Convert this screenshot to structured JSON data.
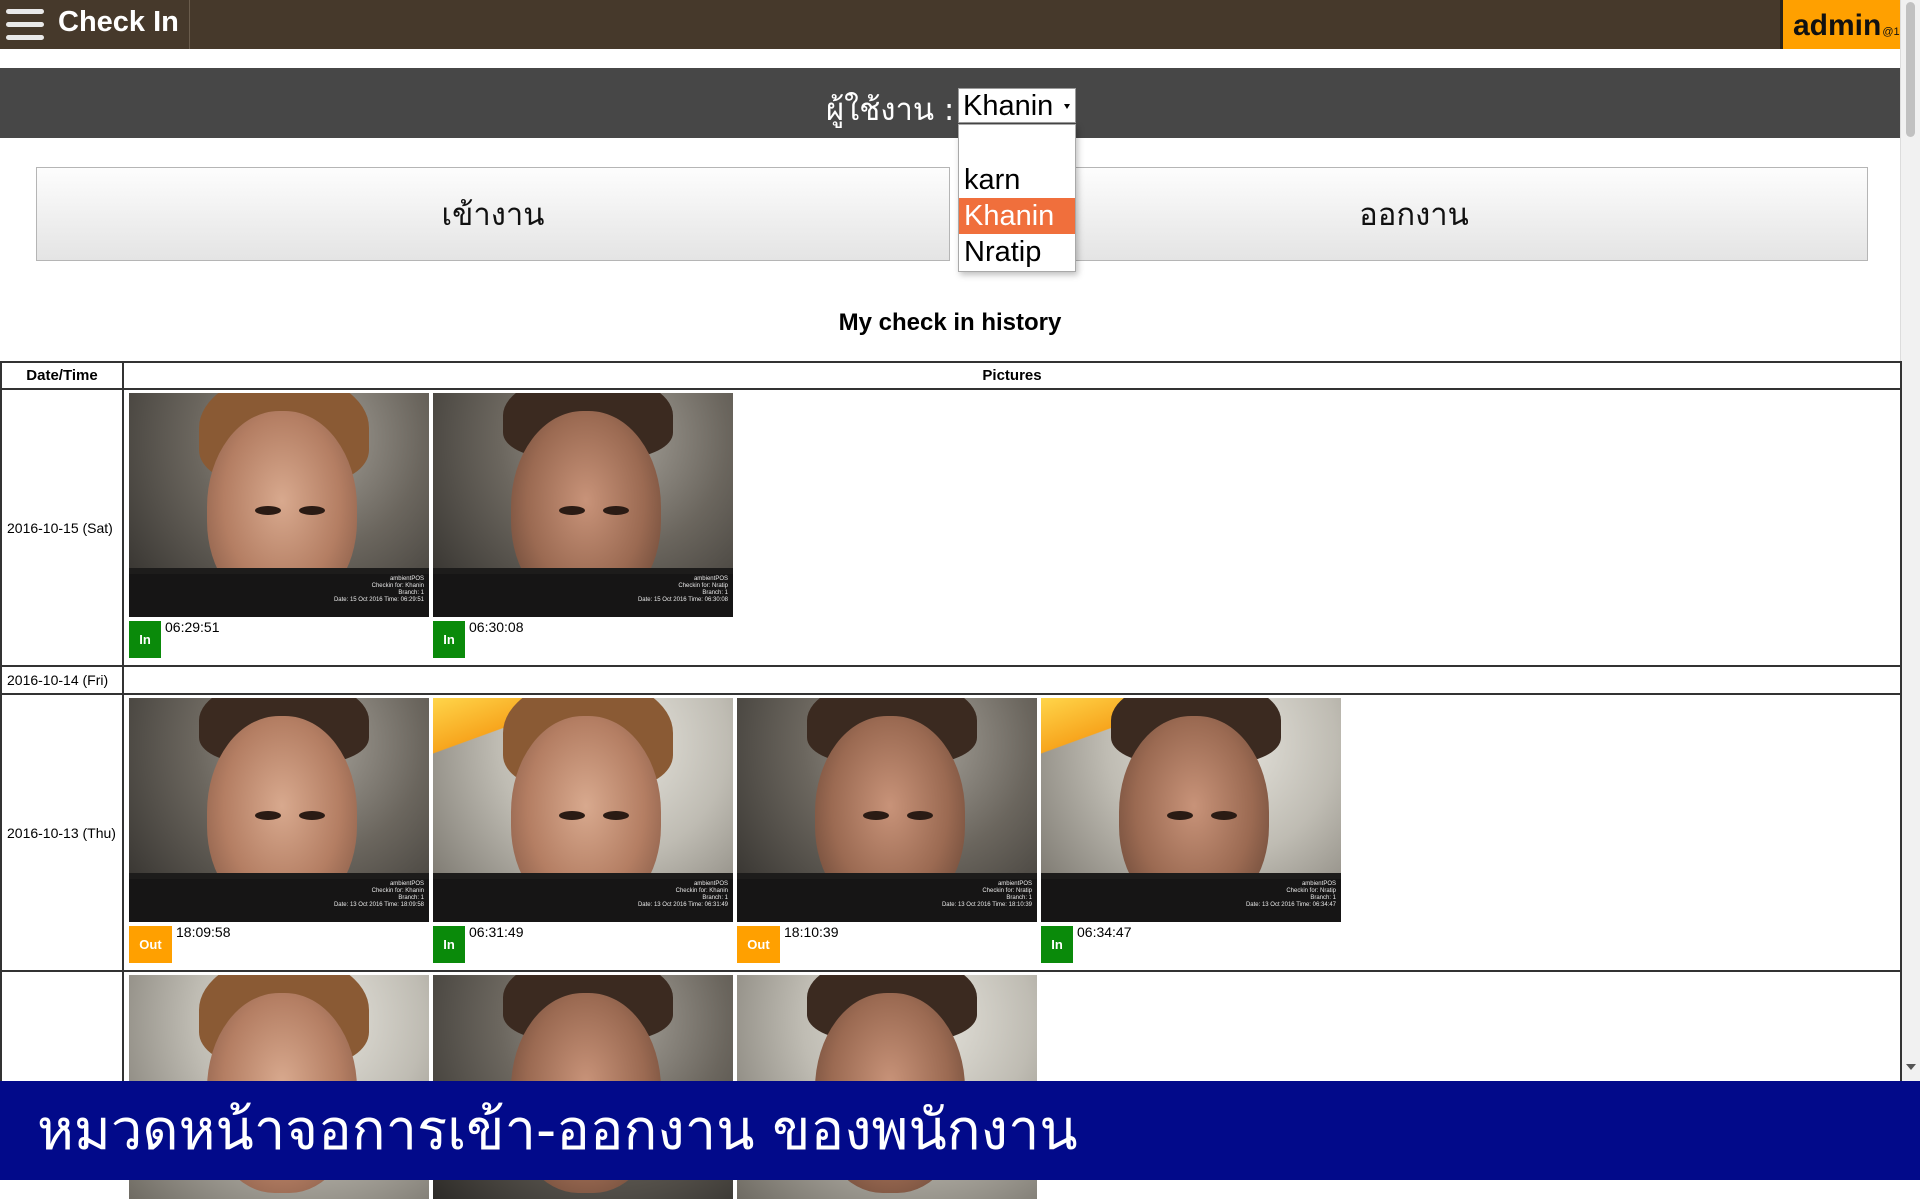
{
  "header": {
    "title": "Check In",
    "user_name": "admin",
    "user_suffix": "@1"
  },
  "user_selector": {
    "label": "ผู้ใช้งาน :",
    "selected": "Khanin",
    "options": [
      "",
      "karn",
      "Khanin",
      "Nratip"
    ]
  },
  "actions": {
    "check_in_label": "เข้างาน",
    "check_out_label": "ออกงาน"
  },
  "history": {
    "title": "My check in history",
    "columns": [
      "Date/Time",
      "Pictures"
    ],
    "rows": [
      {
        "date": "2016-10-15 (Sat)",
        "pictures": [
          {
            "type": "In",
            "time": "06:29:51",
            "caption": [
              "ambientPOS",
              "Checkin for: Khanin",
              "Branch: 1",
              "Date: 15 Oct 2016 Time: 06:29:51"
            ]
          },
          {
            "type": "In",
            "time": "06:30:08",
            "caption": [
              "ambientPOS",
              "Checkin for: Nratip",
              "Branch: 1",
              "Date: 15 Oct 2016 Time: 06:30:08"
            ]
          }
        ]
      },
      {
        "date": "2016-10-14 (Fri)",
        "pictures": []
      },
      {
        "date": "2016-10-13 (Thu)",
        "pictures": [
          {
            "type": "Out",
            "time": "18:09:58",
            "caption": [
              "ambientPOS",
              "Checkin for: Khanin",
              "Branch: 1",
              "Date: 13 Oct 2016 Time: 18:09:58"
            ]
          },
          {
            "type": "In",
            "time": "06:31:49",
            "caption": [
              "ambientPOS",
              "Checkin for: Khanin",
              "Branch: 1",
              "Date: 13 Oct 2016 Time: 06:31:49"
            ]
          },
          {
            "type": "Out",
            "time": "18:10:39",
            "caption": [
              "ambientPOS",
              "Checkin for: Nratip",
              "Branch: 1",
              "Date: 13 Oct 2016 Time: 18:10:39"
            ]
          },
          {
            "type": "In",
            "time": "06:34:47",
            "caption": [
              "ambientPOS",
              "Checkin for: Nratip",
              "Branch: 1",
              "Date: 13 Oct 2016 Time: 06:34:47"
            ]
          }
        ]
      }
    ]
  },
  "banner": {
    "text": "หมวดหน้าจอการเข้า-ออกงาน ของพนักงาน"
  },
  "colors": {
    "topbar": "#46392b",
    "admin_badge": "#ffa000",
    "userbar": "#474747",
    "selected_option": "#f06f3c",
    "badge_in": "#0a8a0a",
    "badge_out": "#ffa000",
    "banner": "#020a8a"
  }
}
